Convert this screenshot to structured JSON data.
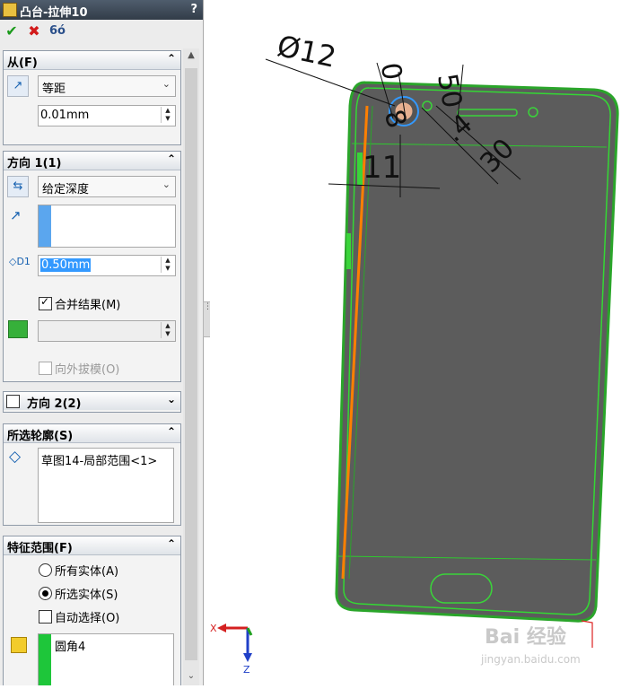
{
  "title": "凸台-拉伸10",
  "help": "?",
  "toolbar": {
    "ok": "✔",
    "cancel": "✖",
    "preview": "6ó"
  },
  "from": {
    "header": "从(F)",
    "type": "等距",
    "offset": "0.01mm"
  },
  "direction1": {
    "header": "方向 1(1)",
    "type": "给定深度",
    "depth": "0.50mm",
    "merge": "合并结果(M)",
    "draft": "向外拔模(O)"
  },
  "direction2": {
    "header": "方向 2(2)"
  },
  "contours": {
    "header": "所选轮廓(S)",
    "item": "草图14-局部范围<1>"
  },
  "scope": {
    "header": "特征范围(F)",
    "all": "所有实体(A)",
    "selected": "所选实体(S)",
    "auto": "自动选择(O)",
    "body": "圆角4"
  },
  "dims": {
    "d1": "Ø12",
    "d2": "0",
    "d3": "50",
    "d4": "11",
    "d5": "8",
    "d6": ".4",
    "d7": "30"
  },
  "triad": {
    "x": "X",
    "z": "Z"
  },
  "watermark": {
    "main": "Bai 经验",
    "sub": "jingyan.baidu.com"
  },
  "colors": {
    "accent": "#3399ff",
    "green": "#22c22e",
    "orange": "#ff7f00"
  }
}
